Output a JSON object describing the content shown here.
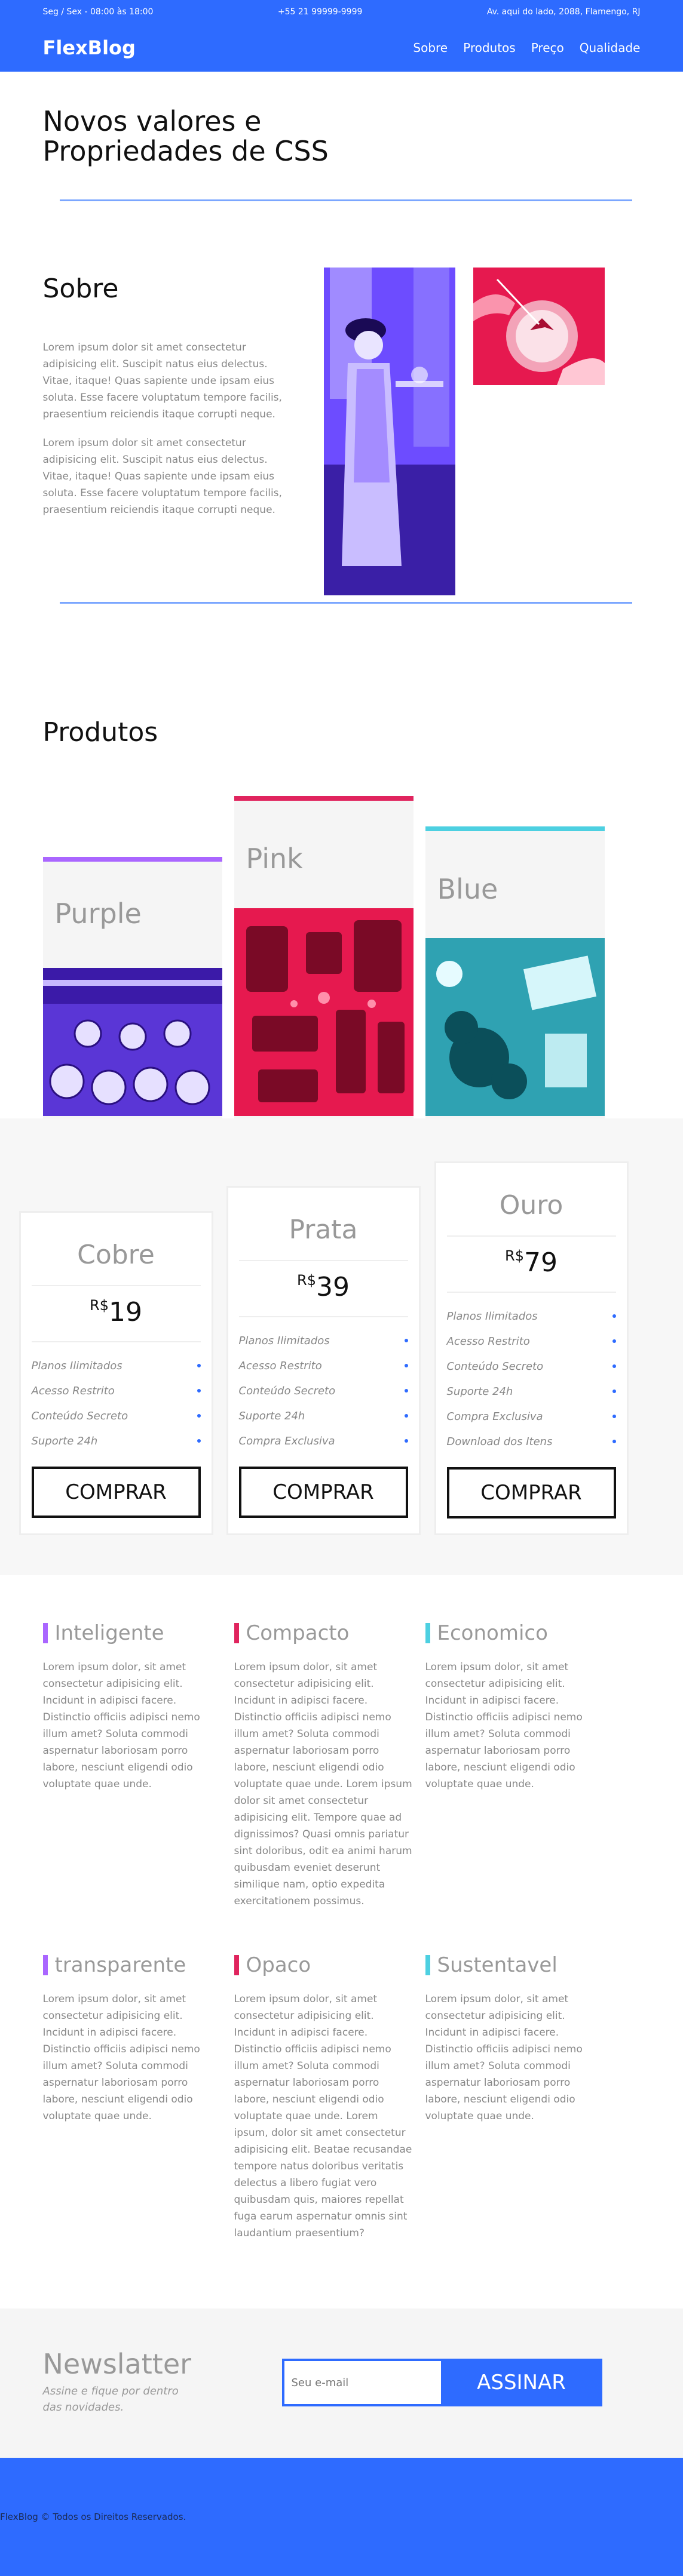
{
  "topbar": {
    "hours": "Seg / Sex - 08:00 às 18:00",
    "phone": "+55 21 99999-9999",
    "address": "Av. aqui do lado, 2088, Flamengo, RJ"
  },
  "nav": {
    "logo": "FlexBlog",
    "items": [
      "Sobre",
      "Produtos",
      "Preço",
      "Qualidade"
    ]
  },
  "hero": {
    "title_line1": "Novos valores e",
    "title_line2": "Propriedades de CSS"
  },
  "sobre": {
    "title": "Sobre",
    "p1": "Lorem ipsum dolor sit amet consectetur adipisicing elit. Suscipit natus eius delectus. Vitae, itaque! Quas sapiente unde ipsam eius soluta. Esse facere voluptatum tempore facilis, praesentium reiciendis itaque corrupti neque.",
    "p2": "Lorem ipsum dolor sit amet consectetur adipisicing elit. Suscipit natus eius delectus. Vitae, itaque! Quas sapiente unde ipsam eius soluta. Esse facere voluptatum tempore facilis, praesentium reiciendis itaque corrupti neque."
  },
  "produtos": {
    "title": "Produtos",
    "cards": [
      {
        "name": "Purple",
        "color": "#aa66ff"
      },
      {
        "name": "Pink",
        "color": "#e0245e"
      },
      {
        "name": "Blue",
        "color": "#4dd0e1"
      }
    ]
  },
  "planos": [
    {
      "name": "Cobre",
      "currency": "R$",
      "price": "19",
      "features": [
        "Planos Ilimitados",
        "Acesso Restrito",
        "Conteúdo Secreto",
        "Suporte 24h"
      ],
      "button": "COMPRAR"
    },
    {
      "name": "Prata",
      "currency": "R$",
      "price": "39",
      "features": [
        "Planos Ilimitados",
        "Acesso Restrito",
        "Conteúdo Secreto",
        "Suporte 24h",
        "Compra Exclusiva"
      ],
      "button": "COMPRAR"
    },
    {
      "name": "Ouro",
      "currency": "R$",
      "price": "79",
      "features": [
        "Planos Ilimitados",
        "Acesso Restrito",
        "Conteúdo Secreto",
        "Suporte 24h",
        "Compra Exclusiva",
        "Download dos Itens"
      ],
      "button": "COMPRAR"
    }
  ],
  "features": [
    {
      "title": "Inteligente",
      "color": "#aa66ff",
      "text": "Lorem ipsum dolor, sit amet consectetur adipisicing elit. Incidunt in adipisci facere. Distinctio officiis adipisci nemo illum amet? Soluta commodi aspernatur laboriosam porro labore, nesciunt eligendi odio voluptate quae unde."
    },
    {
      "title": "Compacto",
      "color": "#e0245e",
      "text": "Lorem ipsum dolor, sit amet consectetur adipisicing elit. Incidunt in adipisci facere. Distinctio officiis adipisci nemo illum amet? Soluta commodi aspernatur laboriosam porro labore, nesciunt eligendi odio voluptate quae unde. Lorem ipsum dolor sit amet consectetur adipisicing elit. Tempore quae ad dignissimos? Quasi omnis pariatur sint doloribus, odit ea animi harum quibusdam eveniet deserunt similique nam, optio expedita exercitationem possimus."
    },
    {
      "title": "Economico",
      "color": "#4dd0e1",
      "text": "Lorem ipsum dolor, sit amet consectetur adipisicing elit. Incidunt in adipisci facere. Distinctio officiis adipisci nemo illum amet? Soluta commodi aspernatur laboriosam porro labore, nesciunt eligendi odio voluptate quae unde."
    },
    {
      "title": "transparente",
      "color": "#aa66ff",
      "text": "Lorem ipsum dolor, sit amet consectetur adipisicing elit. Incidunt in adipisci facere. Distinctio officiis adipisci nemo illum amet? Soluta commodi aspernatur laboriosam porro labore, nesciunt eligendi odio voluptate quae unde."
    },
    {
      "title": "Opaco",
      "color": "#e0245e",
      "text": "Lorem ipsum dolor, sit amet consectetur adipisicing elit. Incidunt in adipisci facere. Distinctio officiis adipisci nemo illum amet? Soluta commodi aspernatur laboriosam porro labore, nesciunt eligendi odio voluptate quae unde. Lorem ipsum, dolor sit amet consectetur adipisicing elit. Beatae recusandae tempore natus doloribus veritatis delectus a libero fugiat vero quibusdam quis, maiores repellat fuga earum aspernatur omnis sint laudantium praesentium?"
    },
    {
      "title": "Sustentavel",
      "color": "#4dd0e1",
      "text": "Lorem ipsum dolor, sit amet consectetur adipisicing elit. Incidunt in adipisci facere. Distinctio officiis adipisci nemo illum amet? Soluta commodi aspernatur laboriosam porro labore, nesciunt eligendi odio voluptate quae unde."
    }
  ],
  "newsletter": {
    "title": "Newslatter",
    "subtitle": "Assine e fique por dentro das novidades.",
    "placeholder": "Seu e-mail",
    "button": "ASSINAR"
  },
  "footer": {
    "copyright": "FlexBlog © Todos os Direitos Reservados."
  }
}
